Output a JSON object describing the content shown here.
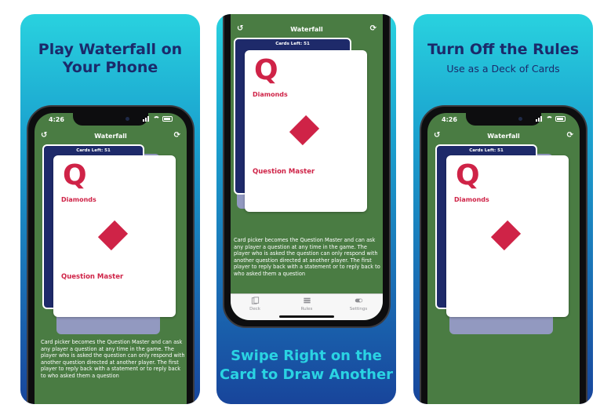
{
  "panel1": {
    "headline_line1": "Play Waterfall on",
    "headline_line2": "Your Phone"
  },
  "panel2": {
    "headline_line1": "Swipe Right on the",
    "headline_line2": "Card to Draw Another"
  },
  "panel3": {
    "headline": "Turn Off the Rules",
    "subhead": "Use as a Deck of Cards"
  },
  "app": {
    "status_time": "4:26",
    "title": "Waterfall",
    "reset_icon": "↺",
    "refresh_icon": "⟳",
    "cards_left": "Cards Left: 51",
    "card": {
      "rank": "Q",
      "suit_name": "Diamonds",
      "rule_name": "Question Master",
      "suit_color": "#cf2347"
    },
    "rule_text": "Card picker becomes the Question Master and can ask any player a question at any time in the game. The player who is asked the question can only respond with another question directed at another player.  The first player to reply back with a statement or to reply back to who asked them a question",
    "tabs": [
      {
        "label": "Deck",
        "icon": "deck-icon"
      },
      {
        "label": "Rules",
        "icon": "list-icon"
      },
      {
        "label": "Settings",
        "icon": "toggle-icon"
      }
    ]
  },
  "colors": {
    "table_green": "#4a7c43",
    "card_back": "#1e2a6a",
    "headline_navy": "#1b2a6b",
    "headline_cyan": "#2ad3e3"
  }
}
